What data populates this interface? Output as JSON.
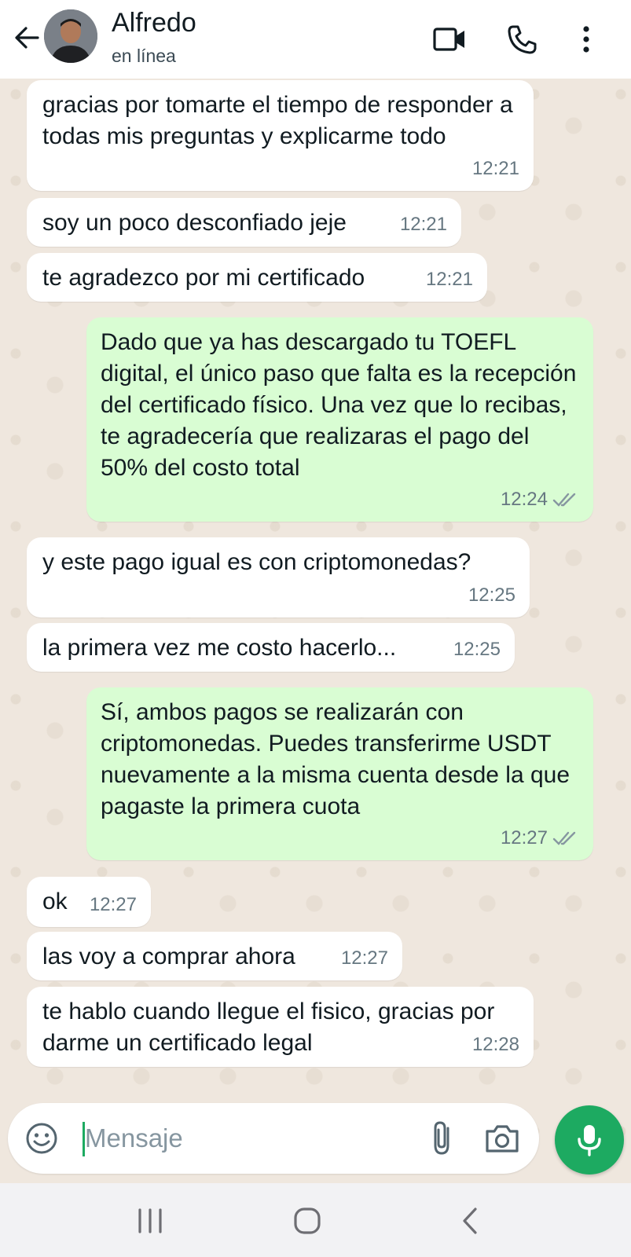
{
  "header": {
    "contact_name": "Alfredo",
    "status": "en línea",
    "icons": [
      "back-arrow-icon",
      "video-call-icon",
      "voice-call-icon",
      "more-options-icon"
    ]
  },
  "messages": [
    {
      "dir": "in",
      "text": "gracias por tomarte el tiempo de responder a todas mis preguntas y explicarme todo",
      "time": "12:21"
    },
    {
      "dir": "in",
      "text": "soy un poco desconfiado jeje",
      "time": "12:21"
    },
    {
      "dir": "in",
      "text": "te agradezco por mi certificado",
      "time": "12:21"
    },
    {
      "dir": "out",
      "text": "Dado que ya has descargado tu TOEFL digital, el único paso que falta es la recepción del certificado físico. Una vez que lo recibas, te agradecería que realizaras el pago del 50% del costo total",
      "time": "12:24",
      "status": "delivered"
    },
    {
      "dir": "in",
      "text": "y este pago igual es con criptomonedas?",
      "time": "12:25"
    },
    {
      "dir": "in",
      "text": "la primera vez me costo hacerlo...",
      "time": "12:25"
    },
    {
      "dir": "out",
      "text": "Sí, ambos pagos se realizarán con criptomonedas. Puedes transferirme USDT nuevamente a la misma cuenta desde la que pagaste la primera cuota",
      "time": "12:27",
      "status": "delivered"
    },
    {
      "dir": "in",
      "text": "ok",
      "time": "12:27"
    },
    {
      "dir": "in",
      "text": "las voy a comprar ahora",
      "time": "12:27"
    },
    {
      "dir": "in",
      "text": "te hablo cuando llegue el fisico, gracias por darme un certificado legal",
      "time": "12:28"
    }
  ],
  "composer": {
    "placeholder": "Mensaje",
    "value": ""
  },
  "colors": {
    "incoming_bubble": "#ffffff",
    "outgoing_bubble": "#d9fdd3",
    "accent": "#1daa61",
    "chat_background": "#efe7de"
  }
}
